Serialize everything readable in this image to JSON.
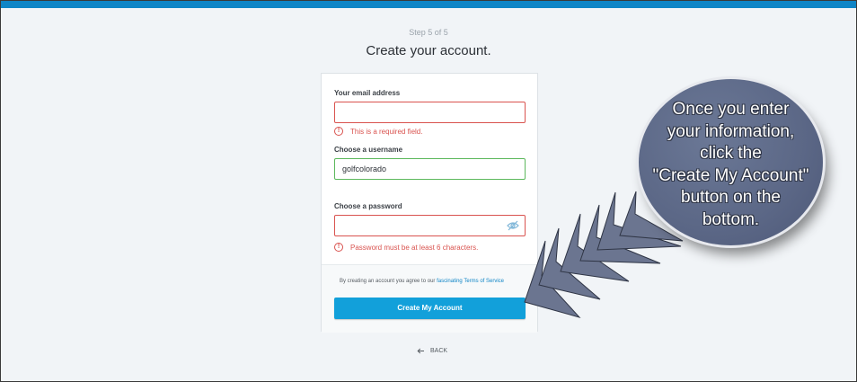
{
  "header": {
    "step": "Step 5 of 5",
    "title": "Create your account."
  },
  "form": {
    "email_label": "Your email address",
    "email_value": "",
    "email_error": "This is a required field.",
    "username_label": "Choose a username",
    "username_value": "golfcolorado",
    "password_label": "Choose a password",
    "password_value": "",
    "password_error": "Password must be at least 6 characters.",
    "terms_prefix": "By creating an account you agree to our",
    "terms_adjective": "fascinating",
    "terms_link": "Terms of Service",
    "submit_label": "Create My Account",
    "back_label": "BACK",
    "error_icon": "!"
  },
  "callout": {
    "lines": [
      "Once you enter",
      "your information,",
      "click the",
      "\"Create My Account\"",
      "button on the",
      "bottom."
    ]
  },
  "colors": {
    "topbar": "#0f85c6",
    "button": "#12a0da",
    "error": "#d9534f",
    "valid": "#5cb85c",
    "bubble": "#5b6786"
  }
}
